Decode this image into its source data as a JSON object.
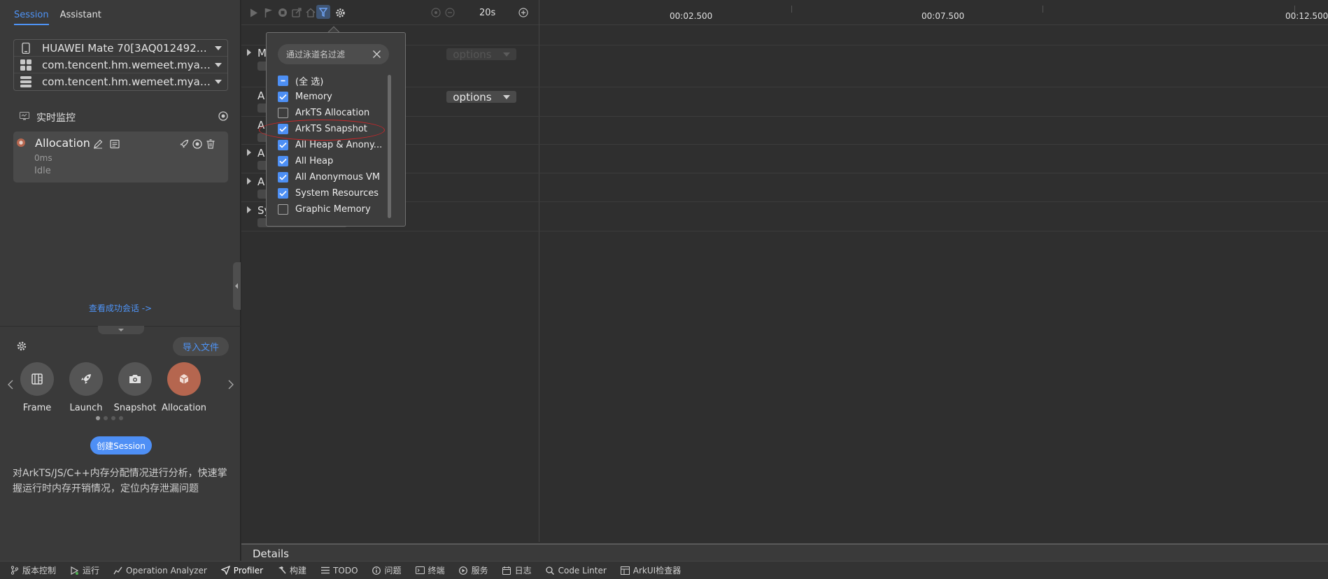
{
  "session_tabs": [
    {
      "label": "Session"
    },
    {
      "label": "Assistant"
    }
  ],
  "devices": [
    {
      "label": "HUAWEI Mate 70[3AQ0124929...",
      "icon": "phone-icon"
    },
    {
      "label": "com.tencent.hm.wemeet.myapp...",
      "icon": "app-grid-icon"
    },
    {
      "label": "com.tencent.hm.wemeet.myapp...",
      "icon": "process-stack-icon"
    }
  ],
  "monitor": {
    "title": "实时监控"
  },
  "allocation_card": {
    "title": "Allocation",
    "time": "0ms",
    "status": "Idle"
  },
  "view_success": "查看成功会话 ->",
  "import_button": "导入文件",
  "tools": [
    {
      "name": "Frame",
      "icon": "frame-icon"
    },
    {
      "name": "Launch",
      "icon": "rocket-icon"
    },
    {
      "name": "Snapshot",
      "icon": "camera-icon"
    },
    {
      "name": "Allocation",
      "icon": "cube-icon",
      "color": "#b5664f"
    }
  ],
  "create_button": "创建Session",
  "description": "对ArkTS/JS/C++内存分配情况进行分析，快速掌握运行时内存开销情况，定位内存泄漏问题",
  "toolbar": {
    "duration": "20s"
  },
  "timeline_ticks": [
    "00:02.500",
    "00:07.500",
    "00:12.500"
  ],
  "lanes": [
    {
      "label": "M",
      "expandable": true
    },
    {
      "label": "A",
      "expandable": false
    },
    {
      "label": "A",
      "expandable": false
    },
    {
      "label": "A",
      "expandable": true
    },
    {
      "label": "A",
      "expandable": true
    },
    {
      "label": "Sy",
      "expandable": true
    }
  ],
  "options_label": "options",
  "details_label": "Details",
  "filter": {
    "placeholder": "通过泳道名过滤",
    "items": [
      {
        "label": "(全 选)",
        "state": "partial"
      },
      {
        "label": "Memory",
        "state": "on"
      },
      {
        "label": "ArkTS Allocation",
        "state": "off"
      },
      {
        "label": "ArkTS Snapshot",
        "state": "on"
      },
      {
        "label": "All Heap & Anony...",
        "state": "on"
      },
      {
        "label": "All Heap",
        "state": "on"
      },
      {
        "label": "All Anonymous VM",
        "state": "on"
      },
      {
        "label": "System Resources",
        "state": "on"
      },
      {
        "label": "Graphic Memory",
        "state": "off"
      }
    ]
  },
  "statusbar": [
    {
      "label": "版本控制",
      "icon": "branch-icon"
    },
    {
      "label": "运行",
      "icon": "run-icon"
    },
    {
      "label": "Operation Analyzer",
      "icon": "analyzer-icon"
    },
    {
      "label": "Profiler",
      "icon": "profiler-icon",
      "active": true
    },
    {
      "label": "构建",
      "icon": "hammer-icon"
    },
    {
      "label": "TODO",
      "icon": "list-icon"
    },
    {
      "label": "问题",
      "icon": "info-icon"
    },
    {
      "label": "终端",
      "icon": "terminal-icon"
    },
    {
      "label": "服务",
      "icon": "service-icon"
    },
    {
      "label": "日志",
      "icon": "log-icon"
    },
    {
      "label": "Code Linter",
      "icon": "linter-icon"
    },
    {
      "label": "ArkUI检查器",
      "icon": "inspector-icon"
    }
  ],
  "colors": {
    "accent": "#4e93f5",
    "checkbox": "#4d8ff4",
    "highlight_ellipse": "#c8282b"
  }
}
